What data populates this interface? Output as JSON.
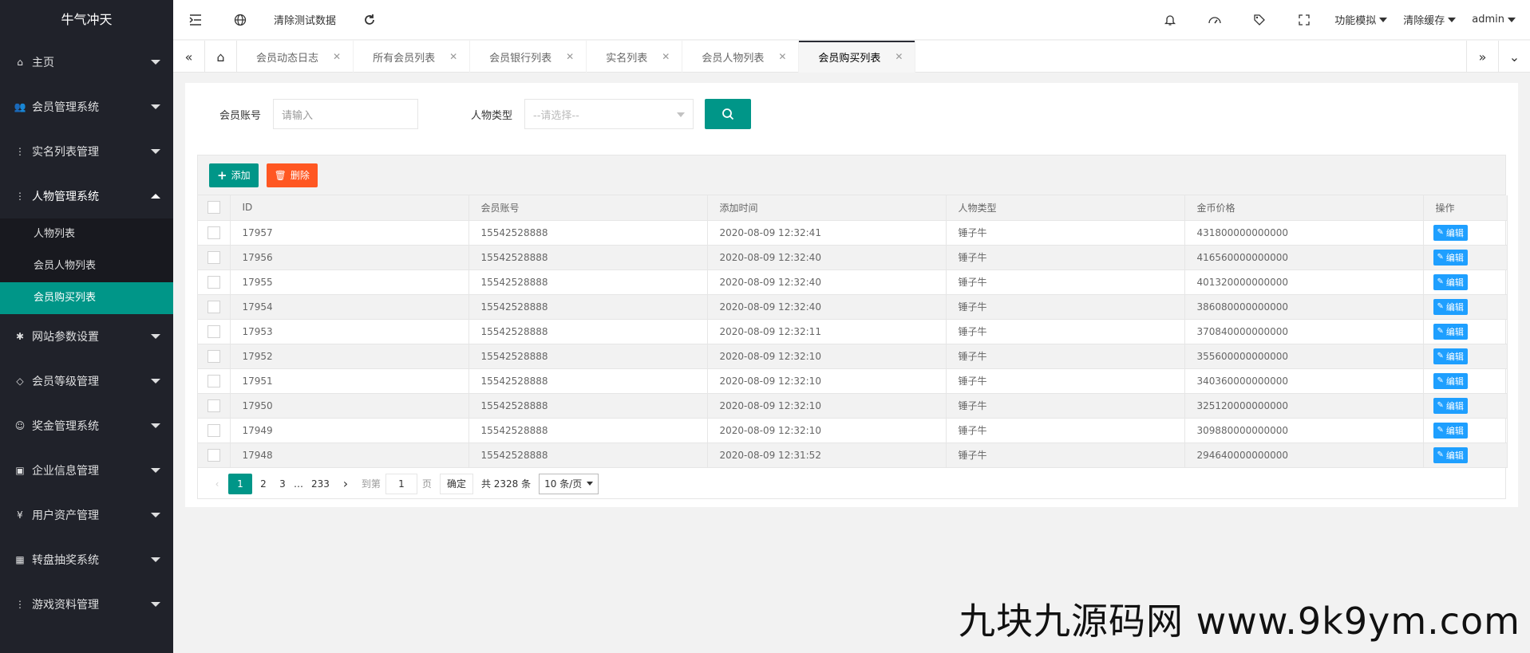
{
  "app": {
    "logo": "牛气冲天"
  },
  "sidebar": {
    "items": [
      {
        "label": "主页",
        "icon": "home-icon",
        "glyph": "⌂"
      },
      {
        "label": "会员管理系统",
        "icon": "users-icon",
        "glyph": "👥"
      },
      {
        "label": "实名列表管理",
        "icon": "more-vertical-icon",
        "glyph": "⋮"
      },
      {
        "label": "人物管理系统",
        "icon": "more-vertical-icon",
        "glyph": "⋮"
      },
      {
        "label": "网站参数设置",
        "icon": "gear-icon",
        "glyph": "✱"
      },
      {
        "label": "会员等级管理",
        "icon": "diamond-icon",
        "glyph": "◇"
      },
      {
        "label": "奖金管理系统",
        "icon": "smile-icon",
        "glyph": "☺"
      },
      {
        "label": "企业信息管理",
        "icon": "form-icon",
        "glyph": "▣"
      },
      {
        "label": "用户资产管理",
        "icon": "yen-icon",
        "glyph": "¥"
      },
      {
        "label": "转盘抽奖系统",
        "icon": "app-icon",
        "glyph": "▦"
      },
      {
        "label": "游戏资料管理",
        "icon": "more-vertical-icon",
        "glyph": "⋮"
      }
    ],
    "subitems": [
      {
        "label": "人物列表"
      },
      {
        "label": "会员人物列表"
      },
      {
        "label": "会员购买列表"
      }
    ]
  },
  "header": {
    "clear_test": "清除测试数据",
    "func_sim": "功能模拟",
    "clear_cache": "清除缓存",
    "user": "admin"
  },
  "tabs": [
    {
      "label": "会员动态日志"
    },
    {
      "label": "所有会员列表"
    },
    {
      "label": "会员银行列表"
    },
    {
      "label": "实名列表"
    },
    {
      "label": "会员人物列表"
    },
    {
      "label": "会员购买列表"
    }
  ],
  "search": {
    "account_label": "会员账号",
    "account_placeholder": "请输入",
    "type_label": "人物类型",
    "type_placeholder": "--请选择--"
  },
  "toolbar": {
    "add": "添加",
    "delete": "删除"
  },
  "table": {
    "columns": [
      "ID",
      "会员账号",
      "添加时间",
      "人物类型",
      "金币价格",
      "操作"
    ],
    "edit_label": "编辑",
    "rows": [
      {
        "id": "17957",
        "account": "15542528888",
        "time": "2020-08-09 12:32:41",
        "type": "锤子牛",
        "price": "431800000000000"
      },
      {
        "id": "17956",
        "account": "15542528888",
        "time": "2020-08-09 12:32:40",
        "type": "锤子牛",
        "price": "416560000000000"
      },
      {
        "id": "17955",
        "account": "15542528888",
        "time": "2020-08-09 12:32:40",
        "type": "锤子牛",
        "price": "401320000000000"
      },
      {
        "id": "17954",
        "account": "15542528888",
        "time": "2020-08-09 12:32:40",
        "type": "锤子牛",
        "price": "386080000000000"
      },
      {
        "id": "17953",
        "account": "15542528888",
        "time": "2020-08-09 12:32:11",
        "type": "锤子牛",
        "price": "370840000000000"
      },
      {
        "id": "17952",
        "account": "15542528888",
        "time": "2020-08-09 12:32:10",
        "type": "锤子牛",
        "price": "355600000000000"
      },
      {
        "id": "17951",
        "account": "15542528888",
        "time": "2020-08-09 12:32:10",
        "type": "锤子牛",
        "price": "340360000000000"
      },
      {
        "id": "17950",
        "account": "15542528888",
        "time": "2020-08-09 12:32:10",
        "type": "锤子牛",
        "price": "325120000000000"
      },
      {
        "id": "17949",
        "account": "15542528888",
        "time": "2020-08-09 12:32:10",
        "type": "锤子牛",
        "price": "309880000000000"
      },
      {
        "id": "17948",
        "account": "15542528888",
        "time": "2020-08-09 12:31:52",
        "type": "锤子牛",
        "price": "294640000000000"
      }
    ]
  },
  "pager": {
    "prev": "‹",
    "next": "›",
    "pages": [
      "1",
      "2",
      "3"
    ],
    "ellipsis": "…",
    "last": "233",
    "goto": "到第",
    "goto_value": "1",
    "page_unit": "页",
    "confirm": "确定",
    "total": "共 2328 条",
    "per_page": "10 条/页"
  },
  "watermark": "九块九源码网 www.9k9ym.com",
  "colors": {
    "primary": "#009688",
    "danger": "#ff5722",
    "edit": "#1e9fff",
    "sidebar": "#20222a"
  }
}
